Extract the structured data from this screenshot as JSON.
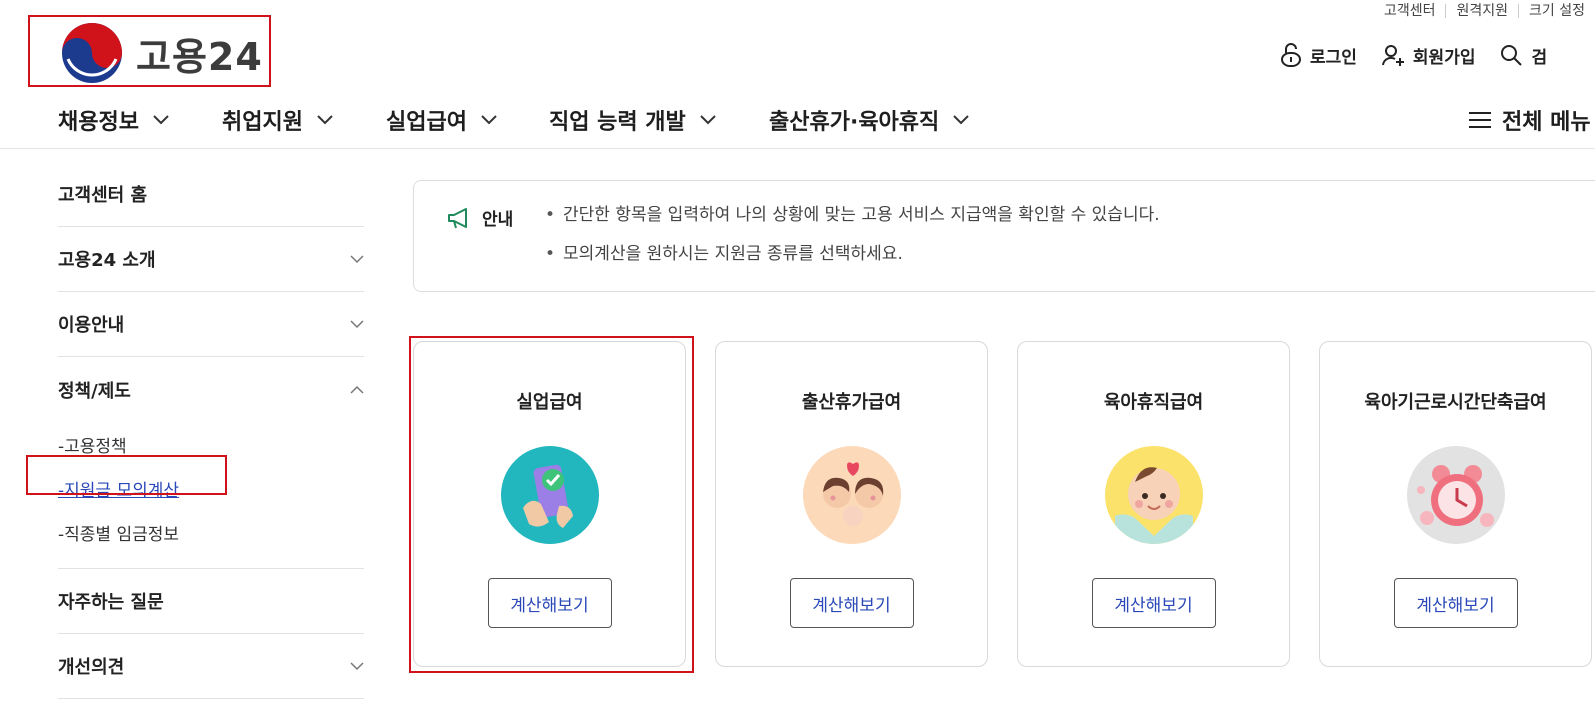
{
  "utility": [
    "고객센터",
    "원격지원",
    "크기 설정"
  ],
  "logo": {
    "text": "고용24"
  },
  "account": {
    "login": "로그인",
    "signup": "회원가입",
    "search": "검"
  },
  "gnb": {
    "items": [
      "채용정보",
      "취업지원",
      "실업급여",
      "직업 능력 개발",
      "출산휴가·육아휴직"
    ],
    "all_menu": "전체 메뉴"
  },
  "sidebar": {
    "home": "고객센터 홈",
    "intro": "고용24 소개",
    "guide": "이용안내",
    "policy": "정책/제도",
    "policy_subs": [
      "-고용정책",
      "-지원금 모의계산",
      "-직종별 임금정보"
    ],
    "faq": "자주하는 질문",
    "feedback": "개선의견"
  },
  "notice": {
    "label": "안내",
    "lines": [
      "간단한 항목을 입력하여 나의 상황에 맞는 고용 서비스 지급액을 확인할 수 있습니다.",
      "모의계산을 원하시는 지원금 종류를 선택하세요."
    ]
  },
  "cards": [
    {
      "title": "실업급여",
      "button": "계산해보기",
      "icon": "phone-check-icon"
    },
    {
      "title": "출산휴가급여",
      "button": "계산해보기",
      "icon": "family-icon"
    },
    {
      "title": "육아휴직급여",
      "button": "계산해보기",
      "icon": "baby-icon"
    },
    {
      "title": "육아기근로시간단축급여",
      "button": "계산해보기",
      "icon": "alarm-clock-icon"
    }
  ],
  "colors": {
    "highlight": "#d0121b",
    "link": "#2a48b8"
  }
}
